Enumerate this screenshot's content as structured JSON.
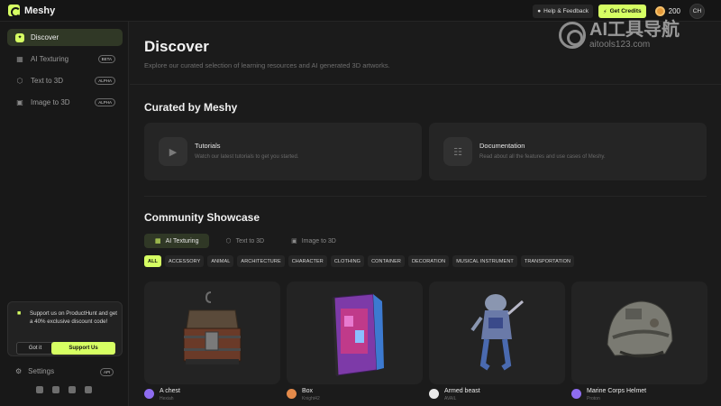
{
  "app": {
    "name": "Meshy"
  },
  "topbar": {
    "help_label": "Help & Feedback",
    "credits_label": "Get Credits",
    "credit_count": "200",
    "user_initials": "CH"
  },
  "sidebar": {
    "items": [
      {
        "label": "Discover",
        "icon": "compass-icon",
        "badge": ""
      },
      {
        "label": "AI Texturing",
        "icon": "texture-icon",
        "badge": "BETA"
      },
      {
        "label": "Text to 3D",
        "icon": "cube-icon",
        "badge": "ALPHA"
      },
      {
        "label": "Image to 3D",
        "icon": "image-icon",
        "badge": "ALPHA"
      }
    ],
    "promo": {
      "text": "Support us on ProductHunt and get a 40% exclusive discount code!",
      "dismiss_label": "Got it",
      "support_label": "Support Us"
    },
    "settings_label": "Settings",
    "settings_badge": "API",
    "socials": [
      "twitter-icon",
      "discord-icon",
      "youtube-icon",
      "instagram-icon"
    ]
  },
  "main": {
    "title": "Discover",
    "subtitle": "Explore our curated selection of learning resources and AI generated 3D artworks.",
    "curated_heading": "Curated by Meshy",
    "cards": [
      {
        "title": "Tutorials",
        "desc": "Watch our latest tutorials to get you started.",
        "icon": "youtube-icon"
      },
      {
        "title": "Documentation",
        "desc": "Read about all the features and use cases of Meshy.",
        "icon": "document-icon"
      }
    ],
    "showcase_heading": "Community Showcase",
    "tabs": [
      {
        "label": "AI Texturing",
        "icon": "texture-icon"
      },
      {
        "label": "Text to 3D",
        "icon": "cube-icon"
      },
      {
        "label": "Image to 3D",
        "icon": "image-icon"
      }
    ],
    "filters": [
      "ALL",
      "ACCESSORY",
      "ANIMAL",
      "ARCHITECTURE",
      "CHARACTER",
      "CLOTHING",
      "CONTAINER",
      "DECORATION",
      "MUSICAL INSTRUMENT",
      "TRANSPORTATION"
    ],
    "models": [
      {
        "name": "A chest",
        "author": "Hexiah",
        "avatar_color": "#8e6cf0"
      },
      {
        "name": "Box",
        "author": "Knight42",
        "avatar_color": "#e48a4a"
      },
      {
        "name": "Armed beast",
        "author": "AVAIL",
        "avatar_color": "#e8e8e8"
      },
      {
        "name": "Marine Corps Helmet",
        "author": "Proton",
        "avatar_color": "#8e6cf0"
      }
    ]
  },
  "watermark": {
    "title": "AI工具导航",
    "sub": "aitools123.com"
  },
  "colors": {
    "accent": "#d6ff63",
    "background": "#1b1b1b",
    "active_bg": "#303826"
  }
}
